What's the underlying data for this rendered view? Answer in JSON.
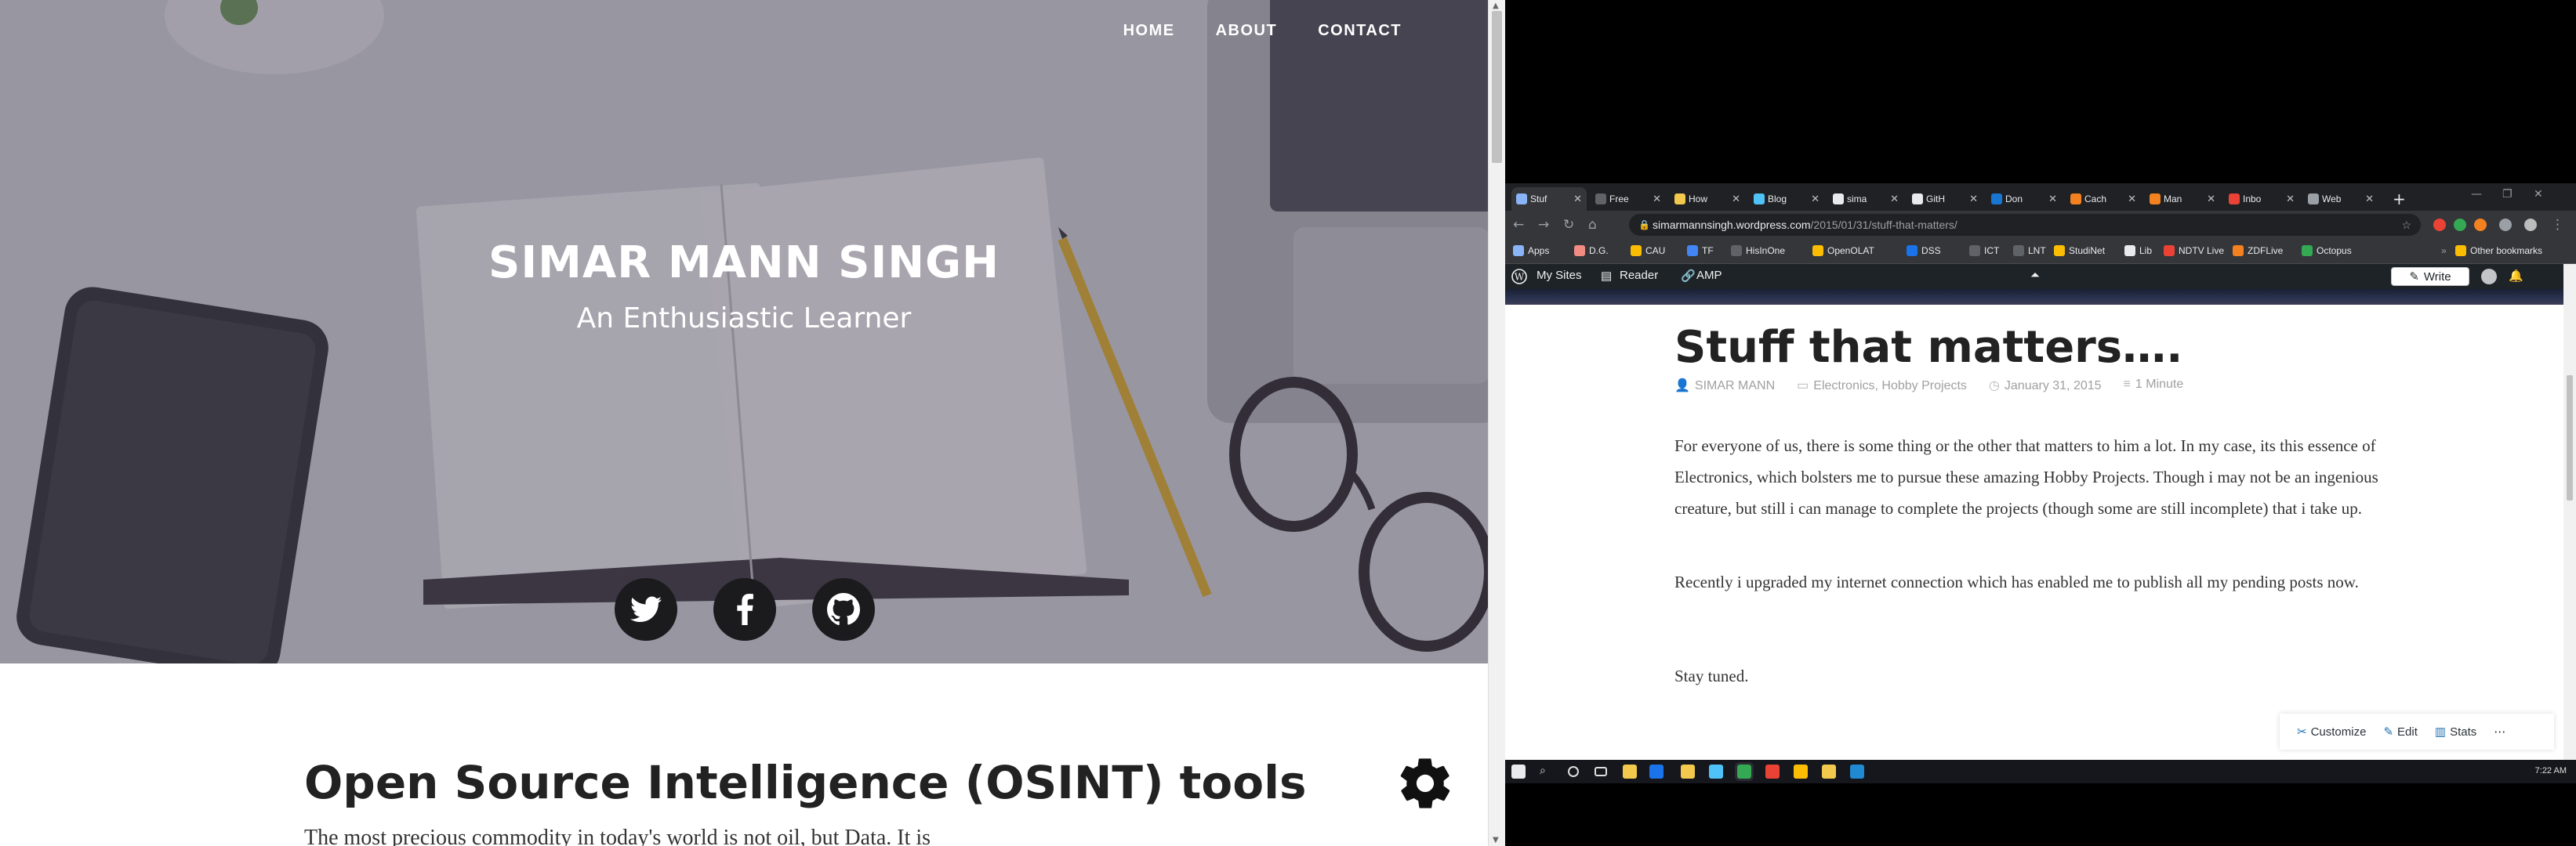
{
  "left_site": {
    "nav": [
      "HOME",
      "ABOUT",
      "CONTACT"
    ],
    "site_title": "SIMAR MANN SINGH",
    "tagline": "An Enthusiastic Learner",
    "social": [
      "twitter-icon",
      "facebook-icon",
      "github-icon"
    ],
    "post_title": "Open Source Intelligence (OSINT) tools",
    "post_excerpt": "The most precious commodity in today's world is not oil, but Data. It is"
  },
  "browser": {
    "tabs": [
      {
        "label": "Stuf",
        "color": "#8ab4f8",
        "active": true
      },
      {
        "label": "Free",
        "color": "#5f6368"
      },
      {
        "label": "How",
        "color": "#f2c94c"
      },
      {
        "label": "Blog",
        "color": "#4fc3f7"
      },
      {
        "label": "sima",
        "color": "#e8eaed"
      },
      {
        "label": "GitH",
        "color": "#e8eaed"
      },
      {
        "label": "Don",
        "color": "#1976d2"
      },
      {
        "label": "Cach",
        "color": "#f48120"
      },
      {
        "label": "Man",
        "color": "#f48120"
      },
      {
        "label": "Inbo",
        "color": "#ea4335"
      },
      {
        "label": "Web",
        "color": "#9aa0a6"
      }
    ],
    "url_host": "simarmannsingh.wordpress.com",
    "url_path": "/2015/01/31/stuff-that-matters/",
    "bookmarks": [
      {
        "label": "Apps",
        "color": "#8ab4f8"
      },
      {
        "label": "D.G.",
        "color": "#f28b82"
      },
      {
        "label": "CAU",
        "color": "#fbbc04"
      },
      {
        "label": "TF",
        "color": "#4285f4"
      },
      {
        "label": "HisInOne",
        "color": "#5f6368"
      },
      {
        "label": "OpenOLAT",
        "color": "#fbbc04"
      },
      {
        "label": "DSS",
        "color": "#1a73e8"
      },
      {
        "label": "ICT",
        "color": "#5f6368"
      },
      {
        "label": "LNT",
        "color": "#5f6368"
      },
      {
        "label": "StudiNet",
        "color": "#fbbc04"
      },
      {
        "label": "Lib",
        "color": "#e8eaed"
      },
      {
        "label": "NDTV Live",
        "color": "#ea4335"
      },
      {
        "label": "ZDFLive",
        "color": "#f48120"
      },
      {
        "label": "Octopus",
        "color": "#34a853"
      }
    ],
    "other_bookmarks": "Other bookmarks",
    "wp_bar": {
      "my_sites": "My Sites",
      "reader": "Reader",
      "amp": "AMP",
      "write": "Write"
    },
    "article": {
      "title": "Stuff that matters….",
      "author": "SIMAR MANN",
      "categories": "Electronics, Hobby Projects",
      "date": "January 31, 2015",
      "read_time": "1 Minute",
      "paragraphs": [
        "For everyone of us, there is some thing or the other that matters to him a lot. In my case, its this essence of Electronics, which bolsters me to pursue these amazing Hobby Projects. Though i may not be an ingenious creature, but still i can manage to complete the projects (though some are still incomplete) that i take up.",
        "Recently i upgraded my internet connection which has enabled me to publish all my pending posts now.",
        "Stay tuned."
      ]
    },
    "wp_actions": {
      "customize": "Customize",
      "edit": "Edit",
      "stats": "Stats"
    }
  },
  "taskbar": {
    "time": "7:22 AM"
  }
}
